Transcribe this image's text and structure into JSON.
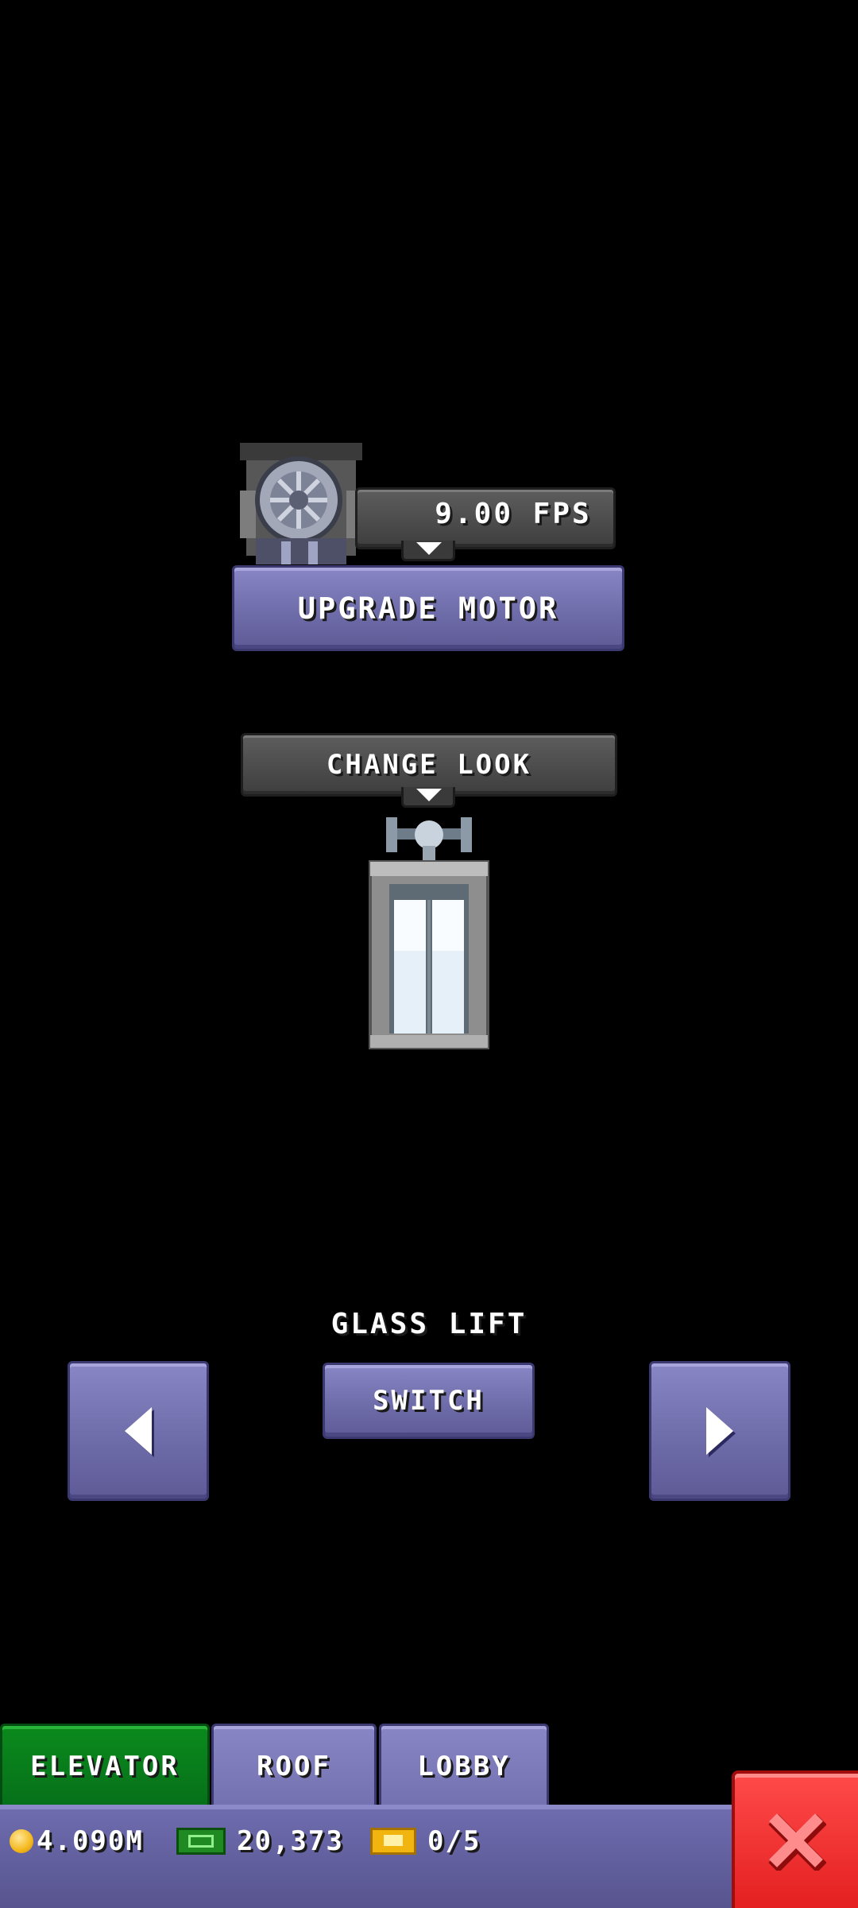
{
  "motor": {
    "speed_label": "9.00 FPS",
    "upgrade_label": "UPGRADE MOTOR"
  },
  "look": {
    "change_label": "CHANGE LOOK",
    "current_name": "GLASS LIFT",
    "switch_label": "SWITCH"
  },
  "tabs": [
    {
      "label": "ELEVATOR",
      "active": true
    },
    {
      "label": "ROOF",
      "active": false
    },
    {
      "label": "LOBBY",
      "active": false
    }
  ],
  "status": {
    "coins": "4.090M",
    "bux": "20,373",
    "tickets": "0/5"
  },
  "colors": {
    "button_purple": "#7471b1",
    "tab_active_green": "#06701a",
    "close_red": "#e42020",
    "panel_gray": "#4a4a4a"
  },
  "icons": [
    "motor-icon",
    "chevron-down-icon",
    "elevator-car-icon",
    "arrow-left-icon",
    "arrow-right-icon",
    "coin-icon",
    "cash-icon",
    "ticket-icon",
    "close-icon"
  ]
}
